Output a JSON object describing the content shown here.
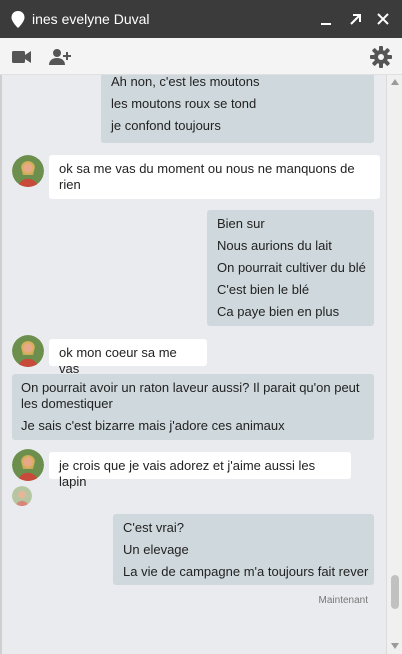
{
  "window": {
    "title": "ines evelyne Duval",
    "controls": [
      "minimize-icon",
      "pop-out-icon",
      "close-icon"
    ]
  },
  "toolbar": {
    "left_icons": [
      "video-call-icon",
      "add-person-icon"
    ],
    "right_icons": [
      "settings-gear-icon"
    ]
  },
  "messages": [
    {
      "from": "me",
      "lines": [
        "Ah non, c'est les moutons",
        "les moutons roux se tond",
        "je confond toujours"
      ]
    },
    {
      "from": "contact",
      "text": "ok sa me vas du moment ou nous ne manquons de rien"
    },
    {
      "from": "me",
      "lines": [
        "Bien sur",
        "Nous aurions du lait",
        "On pourrait cultiver du blé",
        "C'est bien le blé",
        "Ca paye bien en plus"
      ]
    },
    {
      "from": "contact",
      "text": "ok mon coeur sa me vas"
    },
    {
      "from": "me",
      "lines": [
        "On pourrait avoir un raton laveur aussi? Il parait qu'on peut les domestiquer",
        "Je sais c'est bizarre mais j'adore ces animaux"
      ]
    },
    {
      "from": "contact",
      "text": "je crois que je vais adorez et j'aime aussi les lapin"
    },
    {
      "from": "me",
      "lines": [
        "C'est vrai?",
        "Un elevage",
        "La vie de campagne m'a toujours fait rever"
      ]
    }
  ],
  "status": {
    "timestamp": "Maintenant"
  },
  "colors": {
    "titlebar": "#3b3b3b",
    "outgoing_bubble": "#cfd8dc",
    "incoming_bubble": "#ffffff",
    "chat_background": "#e9ebee"
  }
}
